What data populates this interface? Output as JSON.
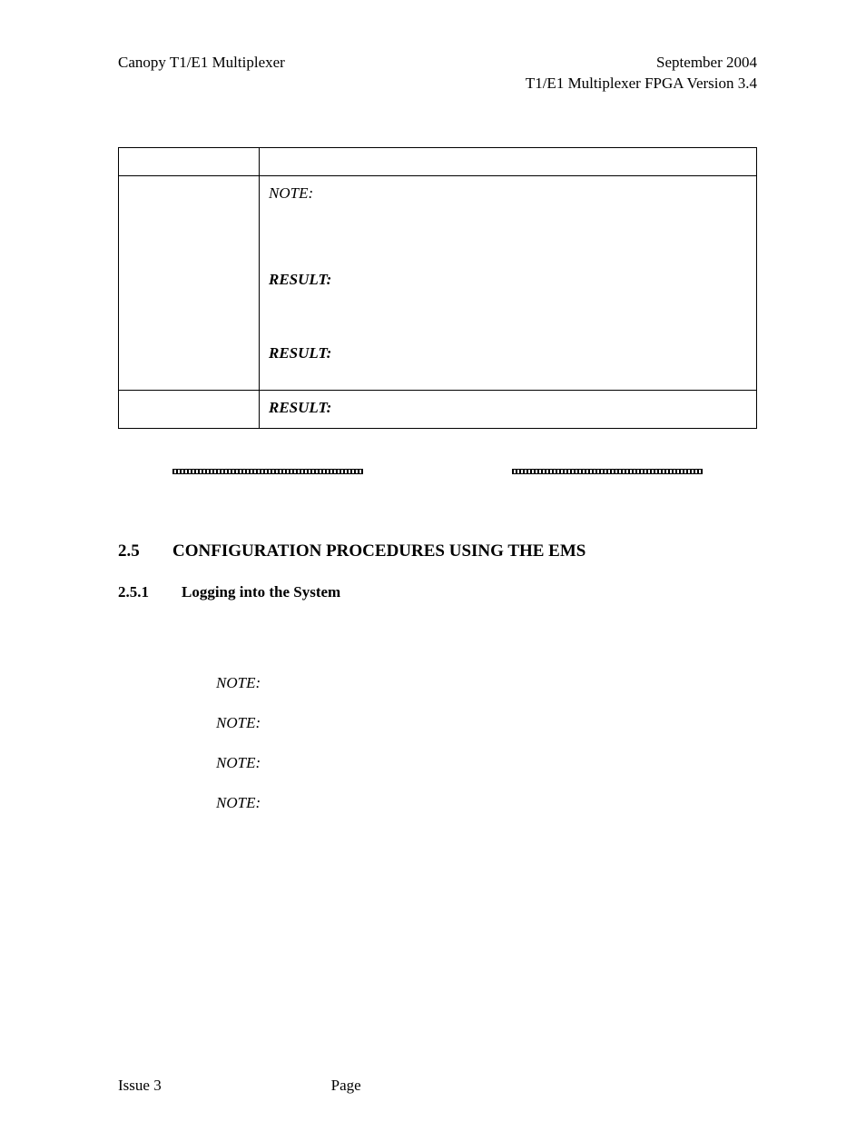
{
  "header": {
    "left": "Canopy T1/E1 Multiplexer",
    "right_line1": "September 2004",
    "right_line2": "T1/E1 Multiplexer FPGA Version 3.4"
  },
  "table": {
    "labels": {
      "note": "NOTE:",
      "result": "RESULT:"
    }
  },
  "section": {
    "num": "2.5",
    "title": "CONFIGURATION PROCEDURES USING THE EMS"
  },
  "subsection": {
    "num": "2.5.1",
    "title": "Logging into the System"
  },
  "notes": {
    "label": "NOTE:"
  },
  "footer": {
    "left": "Issue 3",
    "center": "Page"
  }
}
